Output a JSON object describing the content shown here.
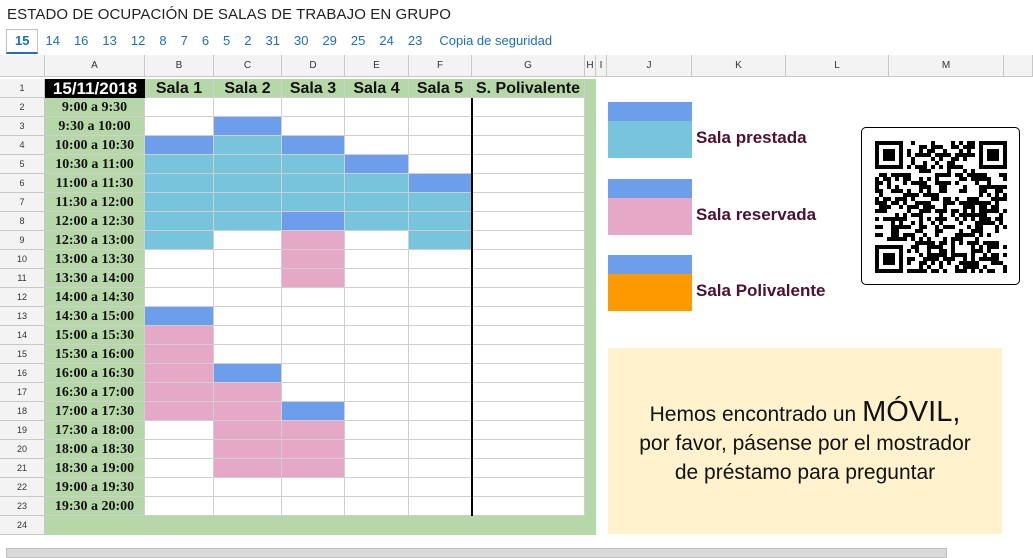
{
  "title": "ESTADO DE OCUPACIÓN DE SALAS DE TRABAJO EN GRUPO",
  "tabs": [
    "15",
    "14",
    "16",
    "13",
    "12",
    "8",
    "7",
    "6",
    "5",
    "2",
    "31",
    "30",
    "29",
    "25",
    "24",
    "23"
  ],
  "active_tab": "15",
  "backup_tab": "Copia de seguridad",
  "columns": [
    "A",
    "B",
    "C",
    "D",
    "E",
    "F",
    "G",
    "H",
    "I",
    "J",
    "K",
    "L",
    "M"
  ],
  "rows": [
    "1",
    "2",
    "3",
    "4",
    "5",
    "6",
    "7",
    "8",
    "9",
    "10",
    "11",
    "12",
    "13",
    "14",
    "15",
    "16",
    "17",
    "18",
    "19",
    "20",
    "21",
    "22",
    "23",
    "24"
  ],
  "sheet": {
    "date": "15/11/2018",
    "rooms": [
      "Sala 1",
      "Sala 2",
      "Sala 3",
      "Sala 4",
      "Sala 5",
      "S. Polivalente"
    ],
    "slots": [
      "9:00 a 9:30",
      "9:30 a 10:00",
      "10:00 a 10:30",
      "10:30 a 11:00",
      "11:00 a 11:30",
      "11:30 a 12:00",
      "12:00 a 12:30",
      "12:30 a 13:00",
      "13:00 a 13:30",
      "13:30 a 14:00",
      "14:00 a 14:30",
      "14:30 a 15:00",
      "15:00 a 15:30",
      "15:30 a 16:00",
      "16:00 a 16:30",
      "16:30 a 17:00",
      "17:00 a 17:30",
      "17:30 a 18:00",
      "18:00 a 18:30",
      "18:30 a 19:00",
      "19:00 a 19:30",
      "19:30 a 20:00"
    ],
    "status": [
      [
        0,
        0,
        0,
        0,
        0,
        0
      ],
      [
        0,
        1,
        0,
        0,
        0,
        0
      ],
      [
        1,
        2,
        1,
        0,
        0,
        0
      ],
      [
        2,
        2,
        2,
        1,
        0,
        0
      ],
      [
        2,
        2,
        2,
        2,
        1,
        0
      ],
      [
        2,
        2,
        2,
        2,
        2,
        0
      ],
      [
        2,
        2,
        1,
        2,
        2,
        0
      ],
      [
        2,
        0,
        3,
        0,
        2,
        0
      ],
      [
        0,
        0,
        3,
        0,
        0,
        0
      ],
      [
        0,
        0,
        3,
        0,
        0,
        0
      ],
      [
        0,
        0,
        0,
        0,
        0,
        0
      ],
      [
        1,
        0,
        0,
        0,
        0,
        0
      ],
      [
        3,
        0,
        0,
        0,
        0,
        0
      ],
      [
        3,
        0,
        0,
        0,
        0,
        0
      ],
      [
        3,
        1,
        0,
        0,
        0,
        0
      ],
      [
        3,
        3,
        0,
        0,
        0,
        0
      ],
      [
        3,
        3,
        1,
        0,
        0,
        0
      ],
      [
        0,
        3,
        3,
        0,
        0,
        0
      ],
      [
        0,
        3,
        3,
        0,
        0,
        0
      ],
      [
        0,
        3,
        3,
        0,
        0,
        0
      ],
      [
        0,
        0,
        0,
        0,
        0,
        0
      ],
      [
        0,
        0,
        0,
        0,
        0,
        0
      ]
    ]
  },
  "legend": [
    {
      "label": "Sala prestada",
      "color": "#76c5dd"
    },
    {
      "label": "Sala reservada",
      "color": "#e6a8c7"
    },
    {
      "label": "Sala Polivalente",
      "color": "#ff9900"
    }
  ],
  "notice": {
    "line1_prefix": "Hemos encontrado un ",
    "line1_big": "MÓVIL,",
    "line2": "por favor, pásense por el mostrador",
    "line3": "de préstamo para preguntar"
  },
  "colors": {
    "blue_bar": "#6d9eeb",
    "lent": "#76c5dd",
    "reserved": "#e6a8c7",
    "polivalente": "#ff9900",
    "header_green": "#b6d7a8",
    "notice_bg": "#fff2cc",
    "tab_link": "#1c6fb8"
  }
}
